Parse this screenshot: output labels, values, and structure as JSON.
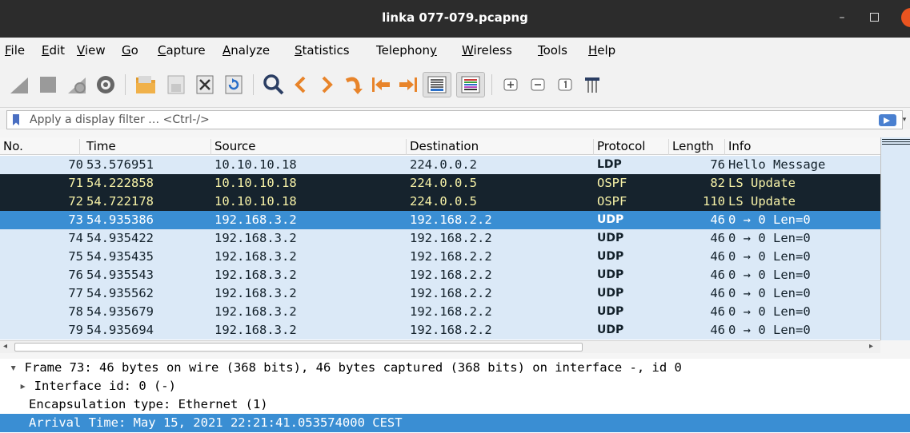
{
  "window": {
    "title": "linka 077-079.pcapng",
    "minimize_glyph": "–"
  },
  "menu": [
    {
      "u": "F",
      "rest": "ile"
    },
    {
      "u": "E",
      "rest": "dit"
    },
    {
      "u": "V",
      "rest": "iew"
    },
    {
      "u": "G",
      "rest": "o"
    },
    {
      "u": "C",
      "rest": "apture"
    },
    {
      "u": "A",
      "rest": "nalyze"
    },
    {
      "u": "S",
      "rest": "tatistics"
    },
    {
      "pre": "Telephon",
      "u": "y",
      "rest": ""
    },
    {
      "u": "W",
      "rest": "ireless"
    },
    {
      "u": "T",
      "rest": "ools"
    },
    {
      "u": "H",
      "rest": "elp"
    }
  ],
  "toolbar": {
    "icons": [
      "start-capture-icon",
      "stop-capture-icon",
      "restart-capture-icon",
      "capture-options-icon",
      "open-file-icon",
      "save-file-icon",
      "close-file-icon",
      "reload-file-icon",
      "find-packet-icon",
      "go-back-icon",
      "go-forward-icon",
      "go-to-packet-icon",
      "go-first-icon",
      "go-last-icon",
      "auto-scroll-icon",
      "colorize-icon",
      "zoom-in-icon",
      "zoom-out-icon",
      "normal-size-icon",
      "resize-columns-icon"
    ]
  },
  "filter": {
    "placeholder": "Apply a display filter … <Ctrl-/>"
  },
  "columns": [
    "No.",
    "Time",
    "Source",
    "Destination",
    "Protocol",
    "Length",
    "Info"
  ],
  "colors": {
    "row_light": "#dbe9f7",
    "row_dark": "#16232d",
    "row_dark_text": "#f8f3a8",
    "row_selected": "#3a8ed3",
    "row_selected_text": "#ffffff"
  },
  "packets": [
    {
      "no": "70",
      "time": "53.576951",
      "src": "10.10.10.18",
      "dst": "224.0.0.2",
      "proto": "LDP",
      "len": "76",
      "info": "Hello Message",
      "style": "light"
    },
    {
      "no": "71",
      "time": "54.222858",
      "src": "10.10.10.18",
      "dst": "224.0.0.5",
      "proto": "OSPF",
      "len": "82",
      "info": "LS Update",
      "style": "dark"
    },
    {
      "no": "72",
      "time": "54.722178",
      "src": "10.10.10.18",
      "dst": "224.0.0.5",
      "proto": "OSPF",
      "len": "110",
      "info": "LS Update",
      "style": "dark"
    },
    {
      "no": "73",
      "time": "54.935386",
      "src": "192.168.3.2",
      "dst": "192.168.2.2",
      "proto": "UDP",
      "len": "46",
      "info": "0 → 0 Len=0",
      "style": "selected"
    },
    {
      "no": "74",
      "time": "54.935422",
      "src": "192.168.3.2",
      "dst": "192.168.2.2",
      "proto": "UDP",
      "len": "46",
      "info": "0 → 0 Len=0",
      "style": "light"
    },
    {
      "no": "75",
      "time": "54.935435",
      "src": "192.168.3.2",
      "dst": "192.168.2.2",
      "proto": "UDP",
      "len": "46",
      "info": "0 → 0 Len=0",
      "style": "light"
    },
    {
      "no": "76",
      "time": "54.935543",
      "src": "192.168.3.2",
      "dst": "192.168.2.2",
      "proto": "UDP",
      "len": "46",
      "info": "0 → 0 Len=0",
      "style": "light"
    },
    {
      "no": "77",
      "time": "54.935562",
      "src": "192.168.3.2",
      "dst": "192.168.2.2",
      "proto": "UDP",
      "len": "46",
      "info": "0 → 0 Len=0",
      "style": "light"
    },
    {
      "no": "78",
      "time": "54.935679",
      "src": "192.168.3.2",
      "dst": "192.168.2.2",
      "proto": "UDP",
      "len": "46",
      "info": "0 → 0 Len=0",
      "style": "light"
    },
    {
      "no": "79",
      "time": "54.935694",
      "src": "192.168.3.2",
      "dst": "192.168.2.2",
      "proto": "UDP",
      "len": "46",
      "info": "0 → 0 Len=0",
      "style": "light"
    }
  ],
  "details": [
    {
      "prefix": "▾ ",
      "text": "Frame 73: 46 bytes on wire (368 bits), 46 bytes captured (368 bits) on interface -, id 0",
      "indent": 0,
      "selected": false
    },
    {
      "prefix": "▸ ",
      "text": "Interface id: 0 (-)",
      "indent": 1,
      "selected": false
    },
    {
      "prefix": "",
      "text": "Encapsulation type: Ethernet (1)",
      "indent": 2,
      "selected": false
    },
    {
      "prefix": "",
      "text": "Arrival Time: May 15, 2021 22:21:41.053574000 CEST",
      "indent": 2,
      "selected": true
    }
  ]
}
